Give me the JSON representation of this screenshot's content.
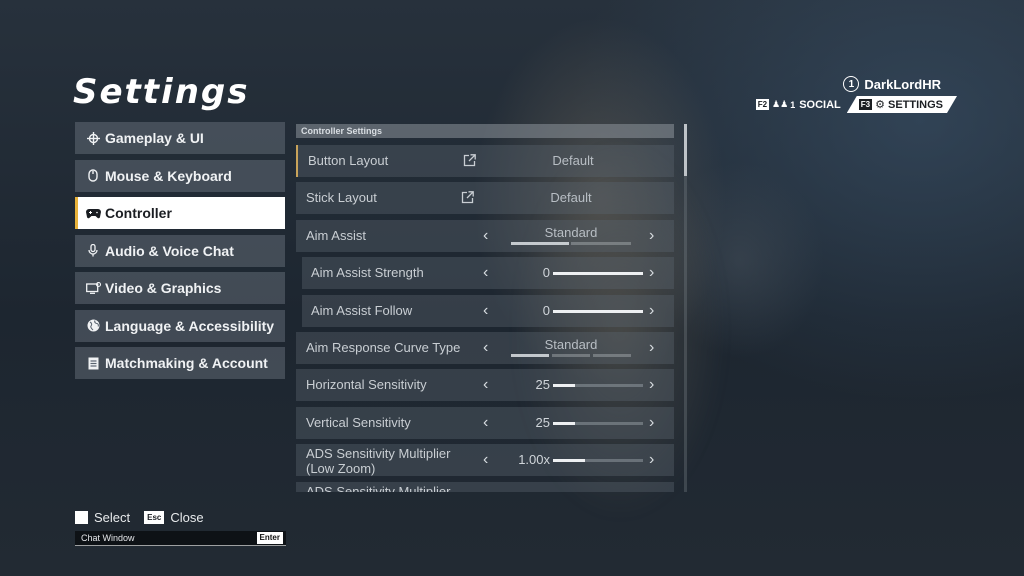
{
  "page_title": "Settings",
  "user": {
    "rank": "1",
    "name": "DarkLordHR"
  },
  "top_nav": {
    "social_key": "F2",
    "social_count": "1",
    "social_label": "SOCIAL",
    "settings_key": "F3",
    "settings_label": "SETTINGS"
  },
  "sidebar": {
    "items": [
      {
        "label": "Gameplay & UI",
        "icon": "crosshair-icon"
      },
      {
        "label": "Mouse & Keyboard",
        "icon": "mouse-icon"
      },
      {
        "label": "Controller",
        "icon": "gamepad-icon",
        "active": true
      },
      {
        "label": "Audio & Voice Chat",
        "icon": "microphone-icon"
      },
      {
        "label": "Video & Graphics",
        "icon": "monitor-icon"
      },
      {
        "label": "Language & Accessibility",
        "icon": "globe-icon"
      },
      {
        "label": "Matchmaking & Account",
        "icon": "document-icon"
      }
    ]
  },
  "panel": {
    "header": "Controller Settings",
    "rows": {
      "button_layout": {
        "label": "Button Layout",
        "value": "Default"
      },
      "stick_layout": {
        "label": "Stick Layout",
        "value": "Default"
      },
      "aim_assist": {
        "label": "Aim Assist",
        "value": "Standard",
        "level": 1,
        "levels": 2
      },
      "aim_assist_strength": {
        "label": "Aim Assist Strength",
        "value": "0",
        "fill_fraction": 1.0
      },
      "aim_assist_follow": {
        "label": "Aim Assist Follow",
        "value": "0",
        "fill_fraction": 1.0
      },
      "aim_response_curve": {
        "label": "Aim Response Curve Type",
        "value": "Standard",
        "level": 1,
        "levels": 3
      },
      "horizontal_sensitivity": {
        "label": "Horizontal Sensitivity",
        "value": "25",
        "fill_fraction": 0.24
      },
      "vertical_sensitivity": {
        "label": "Vertical Sensitivity",
        "value": "25",
        "fill_fraction": 0.24
      },
      "ads_low_zoom": {
        "label_line1": "ADS Sensitivity Multiplier",
        "label_line2": "(Low Zoom)",
        "value": "1.00x",
        "fill_fraction": 0.36
      },
      "ads_next": {
        "label": "ADS Sensitivity Multiplier"
      }
    }
  },
  "footer": {
    "select_label": "Select",
    "close_key": "Esc",
    "close_label": "Close",
    "chat_placeholder": "Chat Window",
    "chat_enter_key": "Enter"
  },
  "colors": {
    "accent": "#e8b23a",
    "active_bg": "#ffffff"
  }
}
